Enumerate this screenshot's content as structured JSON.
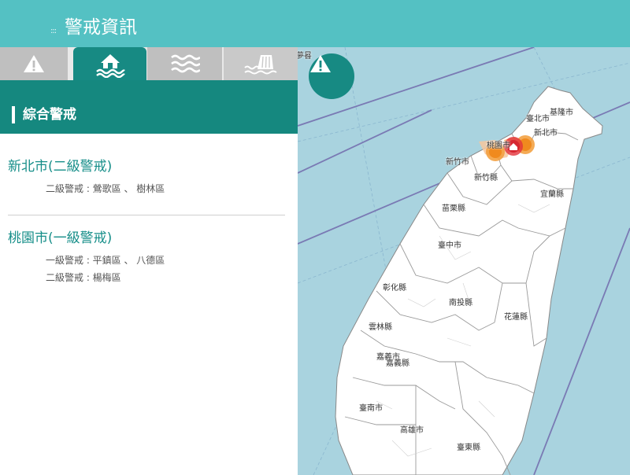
{
  "app": {
    "title": "警戒資訊",
    "title_prefix": ":::"
  },
  "tabs": [
    {
      "icon": "warning-triangle-icon",
      "active": false
    },
    {
      "icon": "flooded-house-icon",
      "active": true
    },
    {
      "icon": "waves-icon",
      "active": false
    },
    {
      "icon": "dam-icon",
      "active": false
    }
  ],
  "section": {
    "title": "綜合警戒"
  },
  "warnings": [
    {
      "title": "新北市(二級警戒)",
      "lines": [
        "二級警戒 : 鶯歌區 、 樹林區"
      ]
    },
    {
      "title": "桃園市(一級警戒)",
      "lines": [
        "一級警戒 : 平鎮區 、 八德區",
        "二級警戒 : 楊梅區"
      ]
    }
  ],
  "map": {
    "button_icon": "warning-triangle-icon",
    "labels": {
      "taipei": "臺北市",
      "keelung": "基隆市",
      "newtaipei": "新北市",
      "taoyuan": "桃園市",
      "hsinchu_city": "新竹市",
      "hsinchu_county": "新竹縣",
      "yilan": "宜蘭縣",
      "miaoli": "苗栗縣",
      "taichung": "臺中市",
      "changhua": "彰化縣",
      "nantou": "南投縣",
      "hualien": "花蓮縣",
      "yunlin": "雲林縣",
      "chiayi_city": "嘉義市",
      "chiayi_county": "嘉義縣",
      "tainan": "臺南市",
      "kaohsiung": "高雄市",
      "taitung": "臺東縣",
      "corner": "夢晷"
    },
    "colors": {
      "sea": "#a9d3df",
      "land": "#ffffff",
      "level1": "#e2323b",
      "level2": "#f29c38",
      "accent": "#178a83"
    }
  }
}
